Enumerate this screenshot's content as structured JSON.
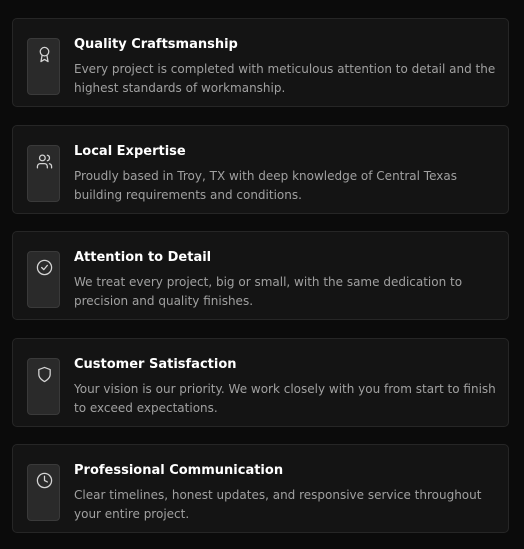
{
  "features": [
    {
      "icon": "award-icon",
      "title": "Quality Craftsmanship",
      "description": "Every project is completed with meticulous attention to detail and the highest standards of workmanship."
    },
    {
      "icon": "users-icon",
      "title": "Local Expertise",
      "description": "Proudly based in Troy, TX with deep knowledge of Central Texas building requirements and conditions."
    },
    {
      "icon": "check-circle-icon",
      "title": "Attention to Detail",
      "description": "We treat every project, big or small, with the same dedication to precision and quality finishes."
    },
    {
      "icon": "shield-icon",
      "title": "Customer Satisfaction",
      "description": "Your vision is our priority. We work closely with you from start to finish to exceed expectations."
    },
    {
      "icon": "clock-icon",
      "title": "Professional Communication",
      "description": "Clear timelines, honest updates, and responsive service throughout your entire project."
    }
  ],
  "colors": {
    "background": "#0b0b0b",
    "card": "#141414",
    "icon_box": "#2a2a2a",
    "title": "#ffffff",
    "description": "#a0a0a0"
  }
}
